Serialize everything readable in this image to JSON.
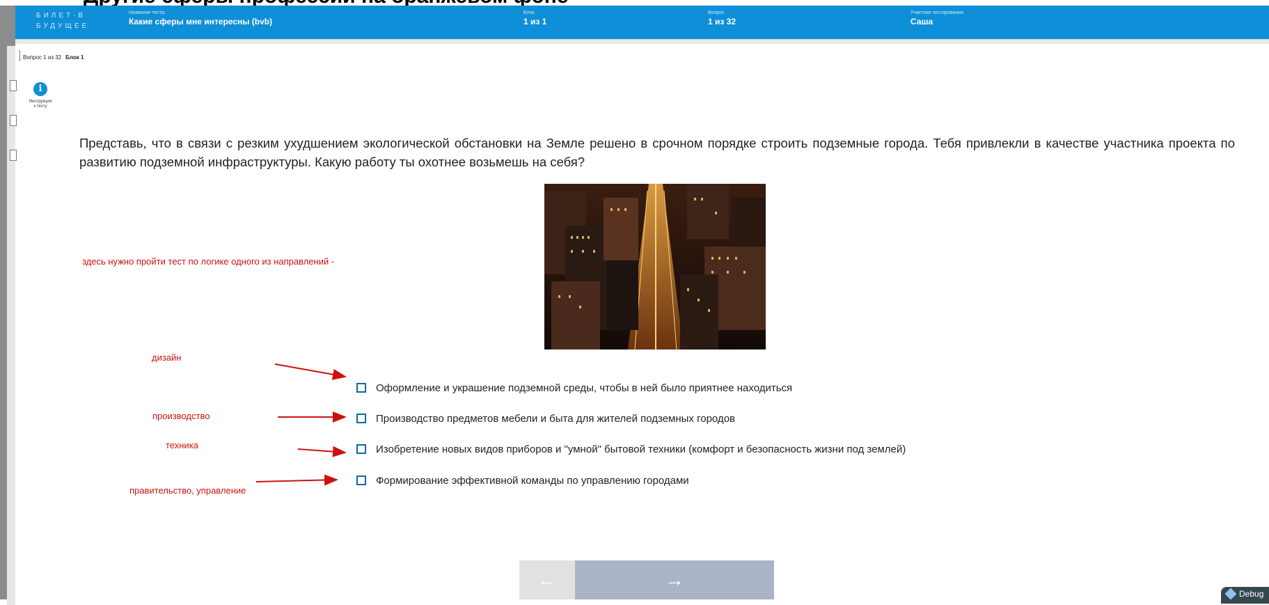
{
  "top_band_text": "Другие сферы профессий на оранжевом фоне",
  "header": {
    "logo_line1": "БИЛЕТ·В",
    "logo_line2": "БУДУЩЕЕ",
    "test_name_label": "Название теста:",
    "test_name_value": "Какие сферы мне интересны (bvb)",
    "block_label": "Блок",
    "block_value": "1 из 1",
    "question_label": "Вопрос",
    "question_value": "1 из 32",
    "participant_label": "Участник тестирования",
    "participant_value": "Саша"
  },
  "breadcrumb": {
    "question_progress": "Вопрос 1 из 32",
    "block": "Блок 1"
  },
  "instruction": {
    "icon": "info-icon",
    "label_line1": "Инструкция",
    "label_line2": "к тесту"
  },
  "question": {
    "text": "Представь, что в связи с резким ухудшением экологической обстановки на Земле решено в срочном порядке строить подземные города. Тебя привлекли в качестве участника проекта по развитию подземной инфраструктуры. Какую работу ты охотнее возьмешь на себя?"
  },
  "options": [
    {
      "label": "Оформление и украшение подземной среды, чтобы в ней было приятнее находиться",
      "checked": false
    },
    {
      "label": "Производство предметов мебели и быта для жителей подземных городов",
      "checked": false
    },
    {
      "label": "Изобретение новых видов приборов и \"умной\" бытовой техники (комфорт и безопасность жизни под землей)",
      "checked": false
    },
    {
      "label": "Формирование эффективной команды по управлению городами",
      "checked": false
    }
  ],
  "annotations": {
    "main_note": "здесь нужно пройти тест по логике одного из направлений -",
    "design": "дизайн",
    "production": "производство",
    "technology": "техника",
    "government": "правительство, управление",
    "color": "#cc1111"
  },
  "nav": {
    "prev_symbol": "←",
    "next_symbol": "→"
  },
  "debug_tab_label": "Debug",
  "colors": {
    "header": "#0f8fd7",
    "next_button": "#a9b5c6",
    "prev_button": "#e1e1e1"
  }
}
